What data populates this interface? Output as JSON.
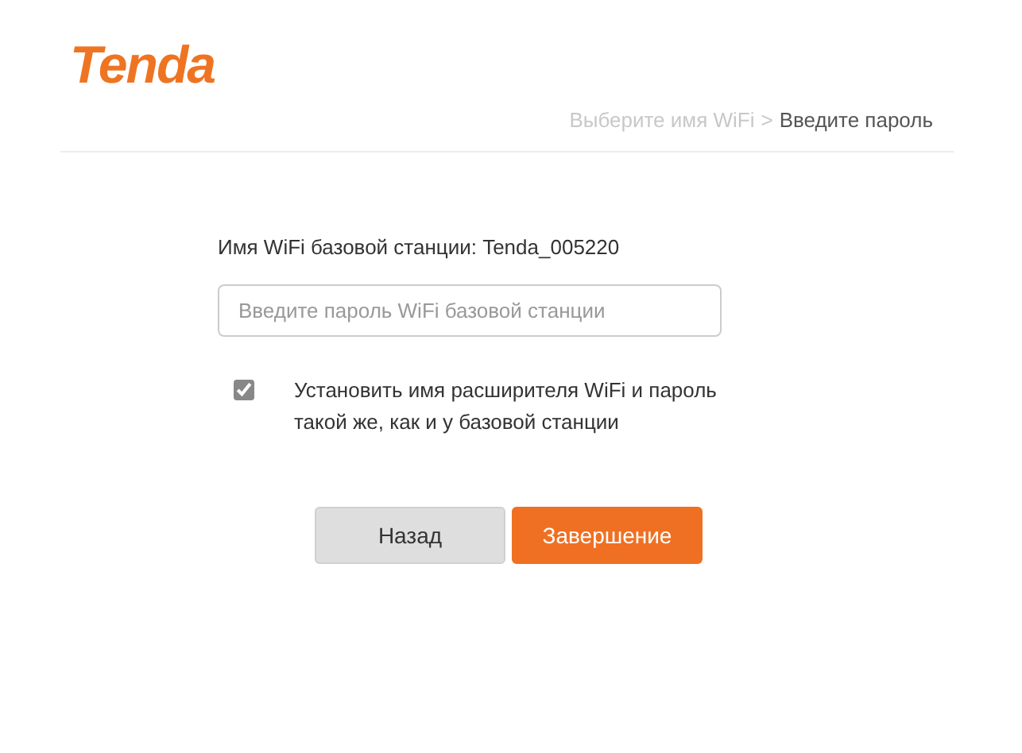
{
  "logo": "Tenda",
  "breadcrumb": {
    "separator": ">",
    "steps": [
      {
        "label": "Выберите имя WiFi",
        "selected": false
      },
      {
        "label": "Введите пароль",
        "selected": true
      }
    ]
  },
  "base_station": "Имя WiFi базовой станции: Tenda_005220",
  "password": {
    "placeholder": "Введите пароль WiFi базовой станции"
  },
  "same_settings": {
    "label": "Установить имя расширителя WiFi и пароль такой же, как и у базовой станции",
    "checked": true
  },
  "buttons": [
    {
      "label": "Назад",
      "kind": "secondary"
    },
    {
      "label": "Завершение",
      "kind": "primary"
    }
  ]
}
